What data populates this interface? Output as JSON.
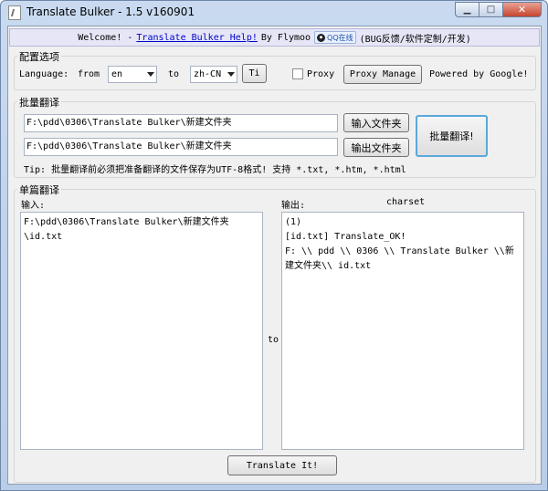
{
  "window": {
    "title": "Translate Bulker - 1.5 v160901",
    "minimize_glyph": "▁",
    "maximize_glyph": "□",
    "close_glyph": "✕"
  },
  "welcome": {
    "prefix": "Welcome! -",
    "help_link": "Translate Bulker Help!",
    "by": "By Flymoo",
    "qq_badge": "QQ在线",
    "suffix": "(BUG反馈/软件定制/开发)"
  },
  "config": {
    "title": "配置选项",
    "language_label": "Language:",
    "from_label": "from",
    "from_value": "en",
    "to_label": "to",
    "to_value": "zh-CN",
    "ti_button": "Ti",
    "proxy_checked": false,
    "proxy_label": "Proxy",
    "proxy_manage_button": "Proxy Manage",
    "powered_by": "Powered by Google!"
  },
  "batch": {
    "title": "批量翻译",
    "input_path": "F:\\pdd\\0306\\Translate Bulker\\新建文件夹",
    "input_button": "输入文件夹",
    "output_path": "F:\\pdd\\0306\\Translate Bulker\\新建文件夹",
    "output_button": "输出文件夹",
    "run_button": "批量翻译!",
    "tip": "Tip: 批量翻译前必须把准备翻译的文件保存为UTF-8格式! 支持 *.txt, *.htm, *.html"
  },
  "single": {
    "title": "单篇翻译",
    "input_label": "输入:",
    "output_label": "输出:",
    "charset_label": "charset",
    "to_label": "to",
    "input_text": "F:\\pdd\\0306\\Translate Bulker\\新建文件夹\n\\id.txt",
    "output_text": "(1)\n[id.txt] Translate_OK!\nF: \\\\ pdd \\\\ 0306 \\\\ Translate Bulker \\\\新建文件夹\\\\ id.txt",
    "translate_button": "Translate It!"
  }
}
